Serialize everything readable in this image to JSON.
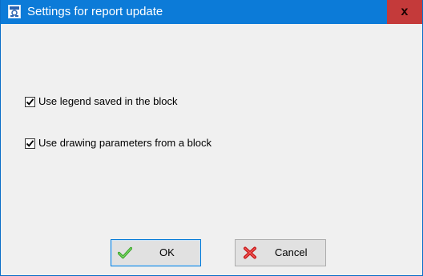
{
  "window": {
    "title": "Settings for report update",
    "close_label": "x"
  },
  "options": [
    {
      "label": "Use legend saved in the block",
      "checked": true
    },
    {
      "label": "Use drawing parameters from a block",
      "checked": true
    }
  ],
  "buttons": {
    "ok_label": "OK",
    "cancel_label": "Cancel"
  },
  "icons": {
    "app": "app-icon",
    "ok": "checkmark-icon",
    "cancel": "red-x-icon"
  },
  "colors": {
    "titlebar": "#0c7bd8",
    "close_button": "#c43a3a",
    "dialog_background": "#f0f0f0"
  }
}
